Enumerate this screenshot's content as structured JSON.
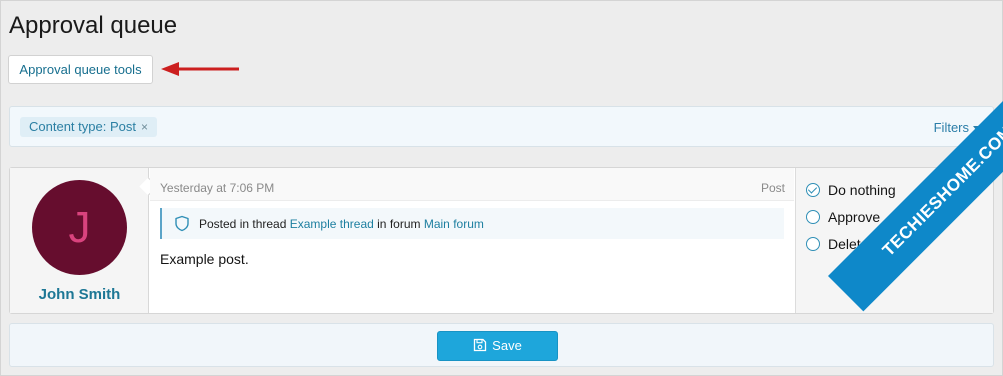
{
  "page": {
    "title": "Approval queue",
    "tools_button_label": "Approval queue tools"
  },
  "filter_bar": {
    "chip_label": "Content type: Post",
    "chip_remove": "×",
    "filters_label": "Filters"
  },
  "item": {
    "avatar_letter": "J",
    "username": "John Smith",
    "timestamp": "Yesterday at 7:06 PM",
    "content_type": "Post",
    "thread_info": {
      "prefix": "Posted in thread",
      "thread_link": "Example thread",
      "middle": "in forum",
      "forum_link": "Main forum"
    },
    "body": "Example post."
  },
  "actions": {
    "options": [
      {
        "label": "Do nothing",
        "checked": true
      },
      {
        "label": "Approve",
        "checked": false
      },
      {
        "label": "Delete",
        "checked": false
      }
    ]
  },
  "footer": {
    "save_label": "Save"
  },
  "watermark": {
    "text": "TECHIESHOME.COM"
  },
  "colors": {
    "link": "#1d7fa0",
    "button_primary": "#1ea6db",
    "avatar_bg": "#660d2e",
    "avatar_letter": "#d9437e",
    "annotation_arrow": "#cc1f1f"
  },
  "icons": {
    "tools_arrow": "annotation-arrow-icon",
    "thread_icon": "shield-icon",
    "save_icon": "floppy-disk-icon",
    "filters_caret": "caret-down-icon"
  }
}
